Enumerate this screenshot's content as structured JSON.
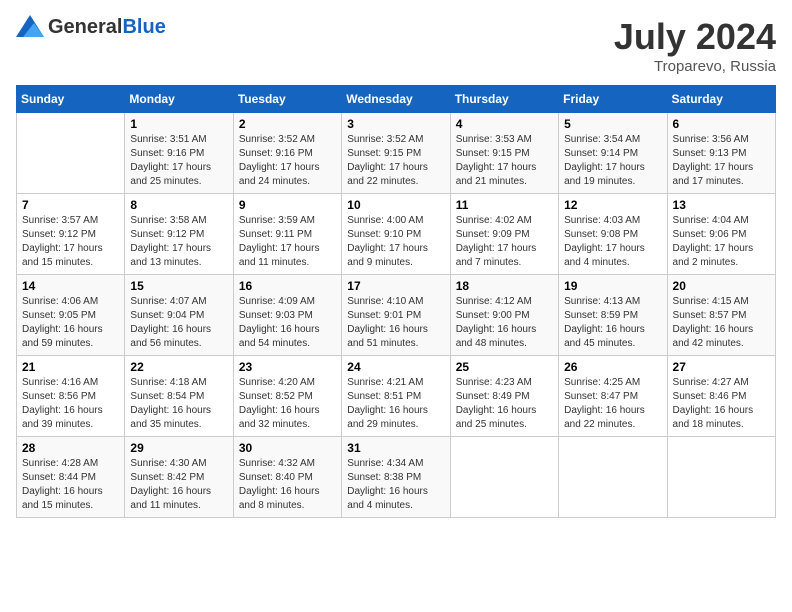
{
  "header": {
    "logo_general": "General",
    "logo_blue": "Blue",
    "month_year": "July 2024",
    "location": "Troparevo, Russia"
  },
  "weekdays": [
    "Sunday",
    "Monday",
    "Tuesday",
    "Wednesday",
    "Thursday",
    "Friday",
    "Saturday"
  ],
  "weeks": [
    [
      {
        "day": "",
        "info": ""
      },
      {
        "day": "1",
        "info": "Sunrise: 3:51 AM\nSunset: 9:16 PM\nDaylight: 17 hours\nand 25 minutes."
      },
      {
        "day": "2",
        "info": "Sunrise: 3:52 AM\nSunset: 9:16 PM\nDaylight: 17 hours\nand 24 minutes."
      },
      {
        "day": "3",
        "info": "Sunrise: 3:52 AM\nSunset: 9:15 PM\nDaylight: 17 hours\nand 22 minutes."
      },
      {
        "day": "4",
        "info": "Sunrise: 3:53 AM\nSunset: 9:15 PM\nDaylight: 17 hours\nand 21 minutes."
      },
      {
        "day": "5",
        "info": "Sunrise: 3:54 AM\nSunset: 9:14 PM\nDaylight: 17 hours\nand 19 minutes."
      },
      {
        "day": "6",
        "info": "Sunrise: 3:56 AM\nSunset: 9:13 PM\nDaylight: 17 hours\nand 17 minutes."
      }
    ],
    [
      {
        "day": "7",
        "info": "Sunrise: 3:57 AM\nSunset: 9:12 PM\nDaylight: 17 hours\nand 15 minutes."
      },
      {
        "day": "8",
        "info": "Sunrise: 3:58 AM\nSunset: 9:12 PM\nDaylight: 17 hours\nand 13 minutes."
      },
      {
        "day": "9",
        "info": "Sunrise: 3:59 AM\nSunset: 9:11 PM\nDaylight: 17 hours\nand 11 minutes."
      },
      {
        "day": "10",
        "info": "Sunrise: 4:00 AM\nSunset: 9:10 PM\nDaylight: 17 hours\nand 9 minutes."
      },
      {
        "day": "11",
        "info": "Sunrise: 4:02 AM\nSunset: 9:09 PM\nDaylight: 17 hours\nand 7 minutes."
      },
      {
        "day": "12",
        "info": "Sunrise: 4:03 AM\nSunset: 9:08 PM\nDaylight: 17 hours\nand 4 minutes."
      },
      {
        "day": "13",
        "info": "Sunrise: 4:04 AM\nSunset: 9:06 PM\nDaylight: 17 hours\nand 2 minutes."
      }
    ],
    [
      {
        "day": "14",
        "info": "Sunrise: 4:06 AM\nSunset: 9:05 PM\nDaylight: 16 hours\nand 59 minutes."
      },
      {
        "day": "15",
        "info": "Sunrise: 4:07 AM\nSunset: 9:04 PM\nDaylight: 16 hours\nand 56 minutes."
      },
      {
        "day": "16",
        "info": "Sunrise: 4:09 AM\nSunset: 9:03 PM\nDaylight: 16 hours\nand 54 minutes."
      },
      {
        "day": "17",
        "info": "Sunrise: 4:10 AM\nSunset: 9:01 PM\nDaylight: 16 hours\nand 51 minutes."
      },
      {
        "day": "18",
        "info": "Sunrise: 4:12 AM\nSunset: 9:00 PM\nDaylight: 16 hours\nand 48 minutes."
      },
      {
        "day": "19",
        "info": "Sunrise: 4:13 AM\nSunset: 8:59 PM\nDaylight: 16 hours\nand 45 minutes."
      },
      {
        "day": "20",
        "info": "Sunrise: 4:15 AM\nSunset: 8:57 PM\nDaylight: 16 hours\nand 42 minutes."
      }
    ],
    [
      {
        "day": "21",
        "info": "Sunrise: 4:16 AM\nSunset: 8:56 PM\nDaylight: 16 hours\nand 39 minutes."
      },
      {
        "day": "22",
        "info": "Sunrise: 4:18 AM\nSunset: 8:54 PM\nDaylight: 16 hours\nand 35 minutes."
      },
      {
        "day": "23",
        "info": "Sunrise: 4:20 AM\nSunset: 8:52 PM\nDaylight: 16 hours\nand 32 minutes."
      },
      {
        "day": "24",
        "info": "Sunrise: 4:21 AM\nSunset: 8:51 PM\nDaylight: 16 hours\nand 29 minutes."
      },
      {
        "day": "25",
        "info": "Sunrise: 4:23 AM\nSunset: 8:49 PM\nDaylight: 16 hours\nand 25 minutes."
      },
      {
        "day": "26",
        "info": "Sunrise: 4:25 AM\nSunset: 8:47 PM\nDaylight: 16 hours\nand 22 minutes."
      },
      {
        "day": "27",
        "info": "Sunrise: 4:27 AM\nSunset: 8:46 PM\nDaylight: 16 hours\nand 18 minutes."
      }
    ],
    [
      {
        "day": "28",
        "info": "Sunrise: 4:28 AM\nSunset: 8:44 PM\nDaylight: 16 hours\nand 15 minutes."
      },
      {
        "day": "29",
        "info": "Sunrise: 4:30 AM\nSunset: 8:42 PM\nDaylight: 16 hours\nand 11 minutes."
      },
      {
        "day": "30",
        "info": "Sunrise: 4:32 AM\nSunset: 8:40 PM\nDaylight: 16 hours\nand 8 minutes."
      },
      {
        "day": "31",
        "info": "Sunrise: 4:34 AM\nSunset: 8:38 PM\nDaylight: 16 hours\nand 4 minutes."
      },
      {
        "day": "",
        "info": ""
      },
      {
        "day": "",
        "info": ""
      },
      {
        "day": "",
        "info": ""
      }
    ]
  ]
}
